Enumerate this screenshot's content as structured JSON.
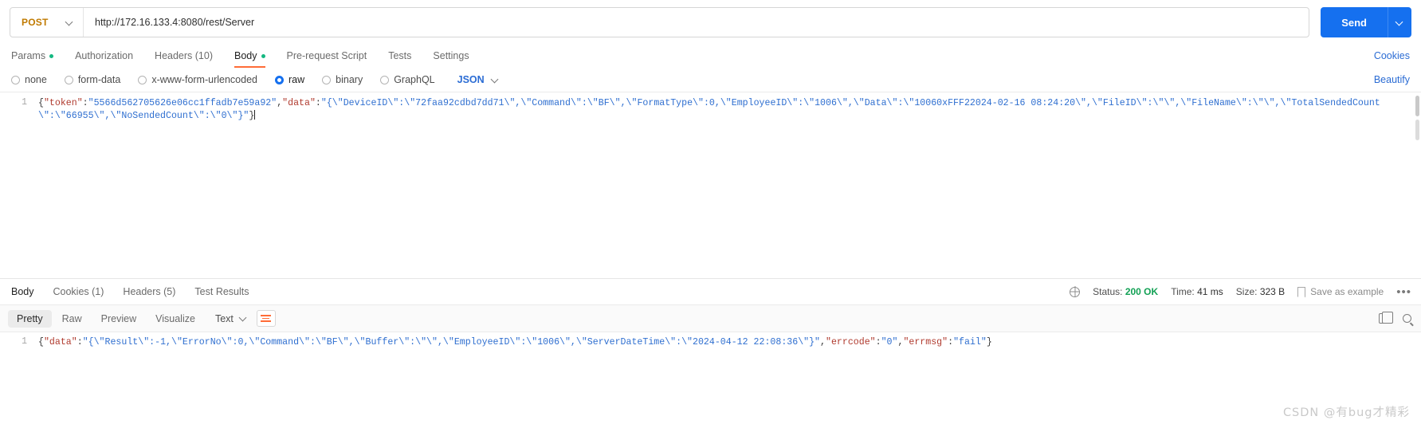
{
  "request": {
    "method": "POST",
    "url": "http://172.16.133.4:8080/rest/Server",
    "send_label": "Send",
    "tabs": [
      {
        "label": "Params",
        "dot": true,
        "active": false
      },
      {
        "label": "Authorization",
        "dot": false,
        "active": false
      },
      {
        "label": "Headers (10)",
        "dot": false,
        "active": false
      },
      {
        "label": "Body",
        "dot": true,
        "active": true
      },
      {
        "label": "Pre-request Script",
        "dot": false,
        "active": false
      },
      {
        "label": "Tests",
        "dot": false,
        "active": false
      },
      {
        "label": "Settings",
        "dot": false,
        "active": false
      }
    ],
    "cookies_link": "Cookies",
    "body_types": [
      {
        "label": "none",
        "checked": false
      },
      {
        "label": "form-data",
        "checked": false
      },
      {
        "label": "x-www-form-urlencoded",
        "checked": false
      },
      {
        "label": "raw",
        "checked": true
      },
      {
        "label": "binary",
        "checked": false
      },
      {
        "label": "GraphQL",
        "checked": false
      }
    ],
    "format_selected": "JSON",
    "beautify_label": "Beautify",
    "editor": {
      "line_numbers": [
        "1"
      ],
      "body_text": "{\"token\":\"5566d562705626e06cc1ffadb7e59a92\",\"data\":\"{\\\"DeviceID\\\":\\\"72faa92cdbd7dd71\\\",\\\"Command\\\":\\\"BF\\\",\\\"FormatType\\\":0,\\\"EmployeeID\\\":\\\"1006\\\",\\\"Data\\\":\\\"10060xFFF22024-02-16 08:24:20\\\",\\\"FileID\\\":\\\"\\\",\\\"FileName\\\":\\\"\\\",\\\"TotalSendedCount\\\":\\\"66955\\\",\\\"NoSendedCount\\\":\\\"0\\\"}\"}"
    }
  },
  "response": {
    "tabs": [
      {
        "label": "Body",
        "active": true
      },
      {
        "label": "Cookies (1)",
        "active": false
      },
      {
        "label": "Headers (5)",
        "active": false
      },
      {
        "label": "Test Results",
        "active": false
      }
    ],
    "status_label": "Status:",
    "status_value": "200 OK",
    "time_label": "Time:",
    "time_value": "41 ms",
    "size_label": "Size:",
    "size_value": "323 B",
    "save_example_label": "Save as example",
    "more_label": "•••",
    "view_modes": [
      {
        "label": "Pretty",
        "active": true
      },
      {
        "label": "Raw",
        "active": false
      },
      {
        "label": "Preview",
        "active": false
      },
      {
        "label": "Visualize",
        "active": false
      }
    ],
    "format_selected": "Text",
    "line_numbers": [
      "1"
    ],
    "body_text": "{\"data\":\"{\\\"Result\\\":-1,\\\"ErrorNo\\\":0,\\\"Command\\\":\\\"BF\\\",\\\"Buffer\\\":\\\"\\\",\\\"EmployeeID\\\":\\\"1006\\\",\\\"ServerDateTime\\\":\\\"2024-04-12 22:08:36\\\"}\",\"errcode\":\"0\",\"errmsg\":\"fail\"}"
  },
  "watermark": "CSDN @有bug才精彩",
  "colors": {
    "accent": "#ff6c37",
    "link": "#2b6cd4",
    "send": "#1570ef",
    "method": "#c07a00",
    "status_ok": "#13a155",
    "dot": "#14b881"
  }
}
